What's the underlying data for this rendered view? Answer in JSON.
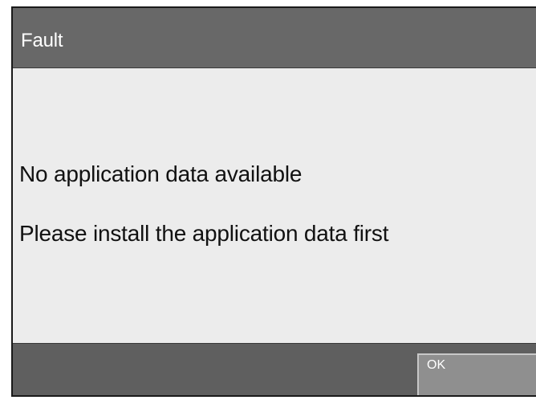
{
  "dialog": {
    "title": "Fault",
    "message_line1": "No application data available",
    "message_line2": "Please install the application data first",
    "ok_label": "OK"
  },
  "colors": {
    "titlebar": "#686868",
    "content_background": "#ececec",
    "footer": "#5f5f5f",
    "button": "#8f8f8f"
  }
}
